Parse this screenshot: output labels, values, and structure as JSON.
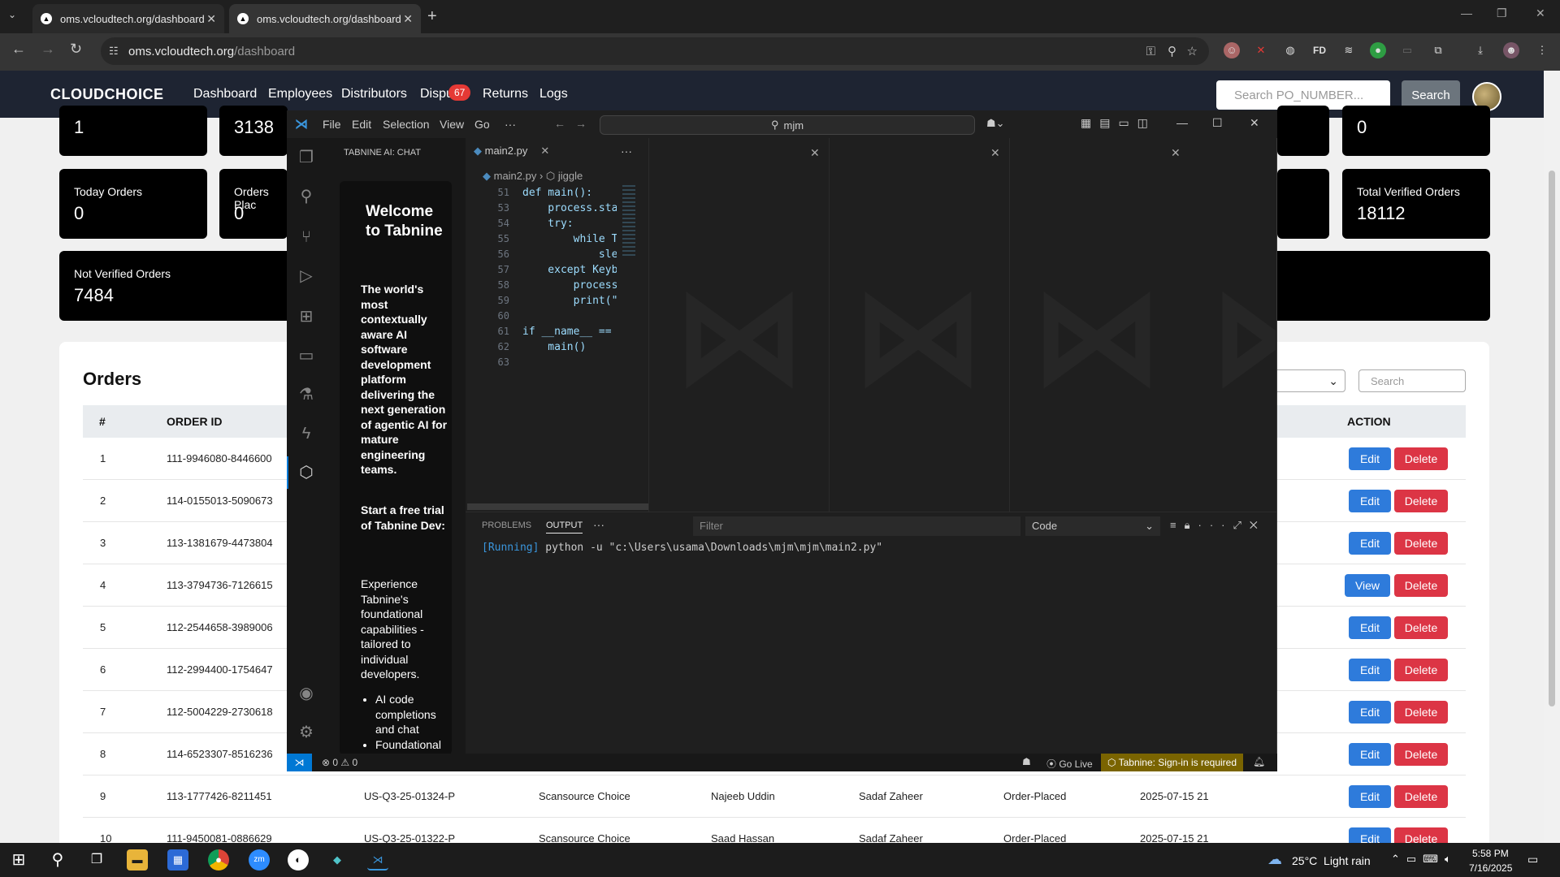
{
  "browser": {
    "tabs": [
      {
        "title": "oms.vcloudtech.org/dashboard"
      },
      {
        "title": "oms.vcloudtech.org/dashboard"
      }
    ],
    "url_host": "oms.vcloudtech.org",
    "url_path": "/dashboard",
    "ext_fd": "FD"
  },
  "site": {
    "logo": "CLOUDCHOICE",
    "nav": [
      "Dashboard",
      "Employees",
      "Distributors",
      "Dispu",
      "Returns",
      "Logs"
    ],
    "disputes_badge": "67",
    "search_placeholder": "Search PO_NUMBER...",
    "search_button": "Search"
  },
  "cards": {
    "top_left_value": "1",
    "top_second_value": "3138",
    "top_right_value": "0",
    "today_orders_label": "Today Orders",
    "today_orders_value": "0",
    "orders_placed_label": "Orders Plac",
    "orders_placed_value": "0",
    "total_verified_label": "Total Verified Orders",
    "total_verified_value": "18112",
    "not_verified_label": "Not Verified Orders",
    "not_verified_value": "7484"
  },
  "orders": {
    "title": "Orders",
    "search_placeholder": "Search",
    "headers": {
      "num": "#",
      "order_id": "ORDER ID",
      "action": "ACTION"
    },
    "rows": [
      {
        "num": "1",
        "order_id": "111-9946080-8446600",
        "action": "Edit"
      },
      {
        "num": "2",
        "order_id": "114-0155013-5090673",
        "action": "Edit"
      },
      {
        "num": "3",
        "order_id": "113-1381679-4473804",
        "action": "Edit"
      },
      {
        "num": "4",
        "order_id": "113-3794736-7126615",
        "action": "View"
      },
      {
        "num": "5",
        "order_id": "112-2544658-3989006",
        "action": "Edit"
      },
      {
        "num": "6",
        "order_id": "112-2994400-1754647",
        "action": "Edit"
      },
      {
        "num": "7",
        "order_id": "112-5004229-2730618",
        "action": "Edit"
      },
      {
        "num": "8",
        "order_id": "114-6523307-8516236",
        "action": "Edit"
      },
      {
        "num": "9",
        "order_id": "113-1777426-8211451",
        "po": "US-Q3-25-01324-P",
        "distributor": "Scansource Choice",
        "employee": "Najeeb Uddin",
        "manager": "Sadaf Zaheer",
        "status": "Order-Placed",
        "date": "2025-07-15 21",
        "action": "Edit"
      },
      {
        "num": "10",
        "order_id": "111-9450081-0886629",
        "po": "US-Q3-25-01322-P",
        "distributor": "Scansource Choice",
        "employee": "Saad Hassan",
        "manager": "Sadaf Zaheer",
        "status": "Order-Placed",
        "date": "2025-07-15 21",
        "action": "Edit"
      }
    ],
    "delete_label": "Delete"
  },
  "vscode": {
    "menu": [
      "File",
      "Edit",
      "Selection",
      "View",
      "Go",
      "···"
    ],
    "search": "mjm",
    "chat_title": "TABNINE AI: CHAT",
    "chat_welcome": "Welcome to Tabnine",
    "chat_p1": "The world's most contextually aware AI software development platform delivering the next generation of agentic AI for mature engineering teams.",
    "chat_p2": "Start a free trial of Tabnine Dev:",
    "chat_p3": "Experience Tabnine's foundational capabilities - tailored to individual developers.",
    "chat_list": [
      "AI code completions and chat",
      "Foundational"
    ],
    "tab_file": "main2.py",
    "breadcrumb_file": "main2.py",
    "breadcrumb_symbol": "jiggle",
    "code_lines": [
      {
        "n": "51",
        "t": "def main():"
      },
      {
        "n": "53",
        "t": "    process.sta"
      },
      {
        "n": "54",
        "t": "    try:"
      },
      {
        "n": "55",
        "t": "        while T"
      },
      {
        "n": "56",
        "t": "            sle"
      },
      {
        "n": "57",
        "t": "    except Keyb"
      },
      {
        "n": "58",
        "t": "        process"
      },
      {
        "n": "59",
        "t": "        print(\""
      },
      {
        "n": "60",
        "t": ""
      },
      {
        "n": "61",
        "t": "if __name__ =="
      },
      {
        "n": "62",
        "t": "    main()"
      },
      {
        "n": "63",
        "t": ""
      }
    ],
    "panel_tabs": [
      "PROBLEMS",
      "OUTPUT"
    ],
    "filter_placeholder": "Filter",
    "output_channel": "Code",
    "output_running": "[Running]",
    "output_cmd": "python -u \"c:\\Users\\usama\\Downloads\\mjm\\mjm\\main2.py\"",
    "status_errors": "0",
    "status_warnings": "0",
    "status_golive": "Go Live",
    "status_tabnine": "Tabnine: Sign-in is required"
  },
  "taskbar": {
    "weather": "25°C  Light rain",
    "time": "5:58 PM",
    "date": "7/16/2025"
  }
}
